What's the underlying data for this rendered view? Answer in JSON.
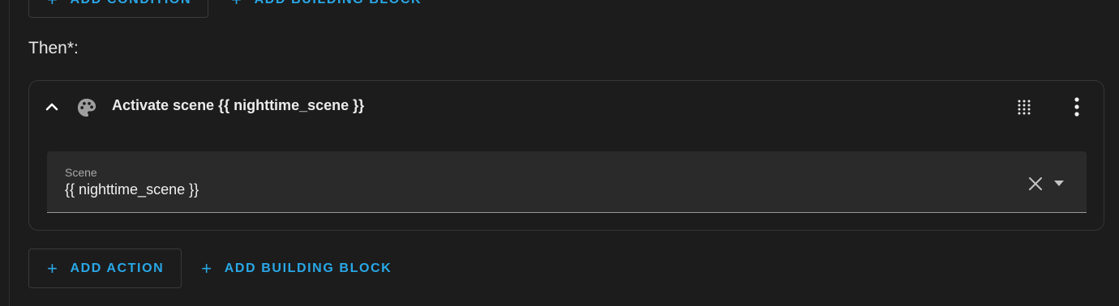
{
  "condition_buttons": {
    "add_condition_label": "ADD CONDITION",
    "add_building_block_label": "ADD BUILDING BLOCK"
  },
  "then_section": {
    "label": "Then*:"
  },
  "action_card": {
    "title": "Activate scene {{ nighttime_scene }}",
    "scene_field": {
      "label": "Scene",
      "value": "{{ nighttime_scene }}"
    }
  },
  "action_buttons": {
    "add_action_label": "ADD ACTION",
    "add_building_block_label": "ADD BUILDING BLOCK"
  },
  "colors": {
    "background": "#1c1c1c",
    "accent": "#29a8e8",
    "field_background": "#2a2a2a",
    "border": "#363636"
  },
  "icons": {
    "collapse": "chevron-up-icon",
    "action_type": "palette-icon",
    "drag": "drag-handle-icon",
    "menu": "more-vertical-icon",
    "clear": "close-icon",
    "dropdown": "dropdown-arrow-icon",
    "add": "plus-icon"
  }
}
